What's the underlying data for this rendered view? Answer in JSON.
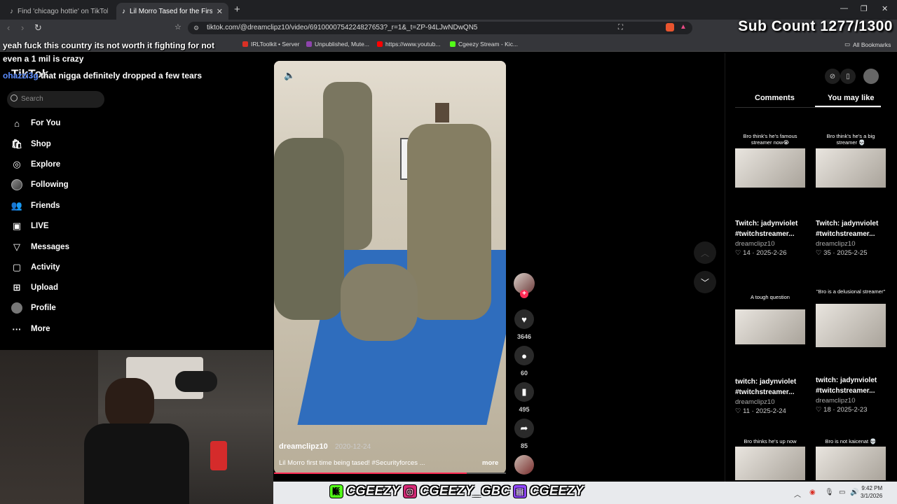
{
  "browser": {
    "tabs": [
      {
        "title": "Find 'chicago hottie' on TikTok | TikTo",
        "active": false
      },
      {
        "title": "Lil Morro Tased for the First Time",
        "active": true
      }
    ],
    "url": "tiktok.com/@dreamclipz10/video/6910000754224827653?_r=1&_t=ZP-94LJwNDwQN5",
    "bookmarks": [
      {
        "label": "IRLToolkit • Server",
        "color": "#d93025"
      },
      {
        "label": "Unpublished, Mute...",
        "color": "#8e44ad"
      },
      {
        "label": "https://www.youtub...",
        "color": "#ff0000"
      },
      {
        "label": "Cgeezy Stream - Kic...",
        "color": "#53fc18"
      }
    ],
    "all_bookmarks": "All Bookmarks"
  },
  "overlay": {
    "sub_count": "Sub Count 1277/1300"
  },
  "chat": [
    {
      "user": "",
      "text": "yeah fuck this country its not worth it fighting for not even a 1 mil is crazy"
    },
    {
      "user": "ohazzi3g",
      "text": "that nigga definitely dropped a few tears"
    }
  ],
  "sidebar": {
    "logo": "TikTok",
    "search_placeholder": "Search",
    "items": [
      {
        "label": "For You",
        "icon": "home-icon"
      },
      {
        "label": "Shop",
        "icon": "shop-icon"
      },
      {
        "label": "Explore",
        "icon": "compass-icon"
      },
      {
        "label": "Following",
        "icon": "following-avatar-icon"
      },
      {
        "label": "Friends",
        "icon": "friends-icon"
      },
      {
        "label": "LIVE",
        "icon": "live-icon"
      },
      {
        "label": "Messages",
        "icon": "messages-icon"
      },
      {
        "label": "Activity",
        "icon": "activity-icon"
      },
      {
        "label": "Upload",
        "icon": "upload-icon"
      },
      {
        "label": "Profile",
        "icon": "profile-avatar-icon"
      },
      {
        "label": "More",
        "icon": "more-icon"
      }
    ]
  },
  "video": {
    "author": "dreamclipz10",
    "date": "2020-12-24",
    "caption": "Lil Morro first time being tased! #Securityforces ...",
    "more": "more",
    "progress": 0.83
  },
  "actions": {
    "likes": "3646",
    "comments": "60",
    "saves": "495",
    "shares": "85"
  },
  "right_panel": {
    "tabs": [
      "Comments",
      "You may like"
    ],
    "active_tab": "You may like",
    "cards": [
      {
        "thumb_text": "Bro think's he's famous streamer now😭",
        "title": "Twitch: jadynviolet",
        "title2": "#twitchstreamer...",
        "author": "dreamclipz10",
        "likes": "14",
        "date": "2025-2-26"
      },
      {
        "thumb_text": "Bro think's he's a big streamer 💀",
        "title": "Twitch: jadynviolet",
        "title2": "#twitchstreamer...",
        "author": "dreamclipz10",
        "likes": "35",
        "date": "2025-2-25"
      },
      {
        "thumb_text": "A tough question",
        "title": "twitch: jadynviolet",
        "title2": "#twitchstreamer...",
        "author": "dreamclipz10",
        "likes": "11",
        "date": "2025-2-24"
      },
      {
        "thumb_text": "\"Bro is a delusional streamer\"",
        "title": "twitch: jadynviolet",
        "title2": "#twitchstreamer...",
        "author": "dreamclipz10",
        "likes": "18",
        "date": "2025-2-23"
      },
      {
        "thumb_text": "Bro thinks he's up now",
        "title": "",
        "title2": "",
        "author": "",
        "likes": "",
        "date": ""
      },
      {
        "thumb_text": "Bro is not kaicenat 💀",
        "title": "",
        "title2": "",
        "author": "",
        "likes": "",
        "date": ""
      }
    ]
  },
  "stream_overlay": {
    "handles": [
      "CGEEZY",
      "CGEEZY_GBC",
      "CGEEZY"
    ],
    "colors": {
      "kick": "#53fc18",
      "instagram": "#d62976",
      "twitch": "#9146ff"
    }
  },
  "taskbar": {
    "time": "9:42 PM",
    "date": "3/1/2026"
  }
}
